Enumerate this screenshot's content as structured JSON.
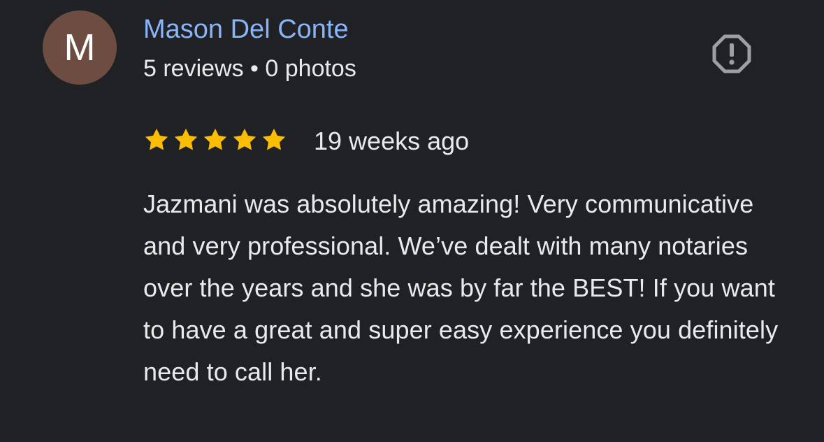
{
  "review": {
    "author": {
      "initial": "M",
      "name": "Mason Del Conte",
      "meta": "5 reviews • 0 photos",
      "avatar_color": "#6d4c41",
      "name_color": "#8ab4f8"
    },
    "rating": {
      "stars": 5,
      "max": 5,
      "star_color": "#fbbc04"
    },
    "date": "19 weeks ago",
    "text": "Jazmani was absolutely amazing! Very communicative and very professional. We’ve dealt with many notaries over the years and she was by far the BEST! If you want to have a great and super easy experience you definitely need to call her.",
    "report_icon": "report-octagon-exclamation-icon"
  }
}
